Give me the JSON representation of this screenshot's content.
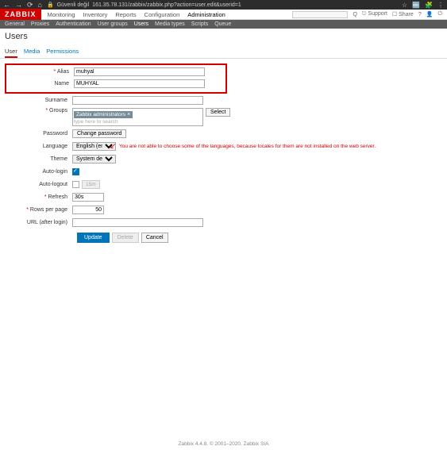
{
  "browser": {
    "security": "Güvenli değil",
    "url": "161.35.78.131/zabbix/zabbix.php?action=user.edit&userid=1"
  },
  "logo": "ZABBIX",
  "topMenu": [
    "Monitoring",
    "Inventory",
    "Reports",
    "Configuration",
    "Administration"
  ],
  "topMenuActive": "Administration",
  "topRight": {
    "support": "⎋ Support",
    "share": "☐ Share"
  },
  "subNav": [
    "General",
    "Proxies",
    "Authentication",
    "User groups",
    "Users",
    "Media types",
    "Scripts",
    "Queue"
  ],
  "subNavActive": "Users",
  "pageTitle": "Users",
  "tabs": [
    "User",
    "Media",
    "Permissions"
  ],
  "tabActive": "User",
  "form": {
    "aliasLabel": "Alias",
    "aliasValue": "muhyal",
    "nameLabel": "Name",
    "nameValue": "MUHYAL",
    "surnameLabel": "Surname",
    "surnameValue": "",
    "groupsLabel": "Groups",
    "groupTag": "Zabbix administrators",
    "groupsHint": "type here to search",
    "selectBtn": "Select",
    "passwordLabel": "Password",
    "changePwBtn": "Change password",
    "languageLabel": "Language",
    "languageValue": "English (en_GB)",
    "languageWarning": "You are not able to choose some of the languages, because locales for them are not installed on the web server.",
    "themeLabel": "Theme",
    "themeValue": "System default",
    "autoLoginLabel": "Auto-login",
    "autoLogoutLabel": "Auto-logout",
    "autoLogoutVal": "15m",
    "refreshLabel": "Refresh",
    "refreshValue": "30s",
    "rowsLabel": "Rows per page",
    "rowsValue": "50",
    "urlLabel": "URL (after login)",
    "urlValue": ""
  },
  "buttons": {
    "update": "Update",
    "delete": "Delete",
    "cancel": "Cancel"
  },
  "footer": "Zabbix 4.4.8. © 2001–2020, Zabbix SIA"
}
